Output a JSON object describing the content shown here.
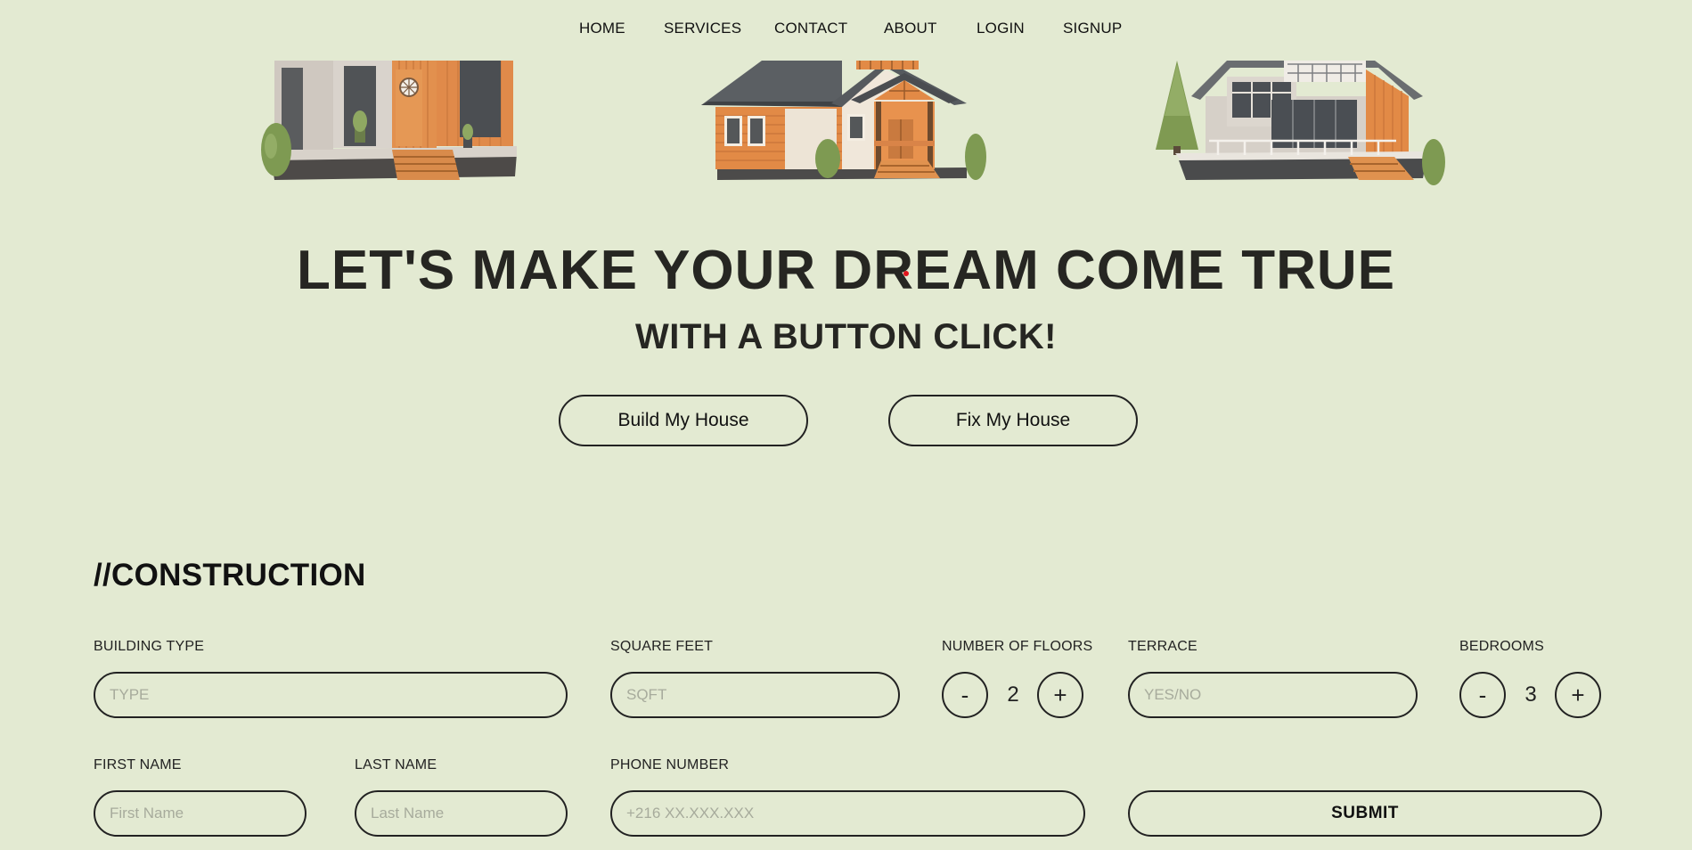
{
  "nav": {
    "items": [
      {
        "label": "HOME"
      },
      {
        "label": "SERVICES"
      },
      {
        "label": "CONTACT"
      },
      {
        "label": "ABOUT"
      },
      {
        "label": "LOGIN"
      },
      {
        "label": "SIGNUP"
      }
    ]
  },
  "hero": {
    "title": "LET'S MAKE YOUR DREAM COME TRUE",
    "subtitle": "WITH A BUTTON CLICK!",
    "build_label": "Build My House",
    "fix_label": "Fix My House"
  },
  "construction": {
    "title": "//CONSTRUCTION",
    "building_type": {
      "label": "BUILDING TYPE",
      "placeholder": "TYPE",
      "value": ""
    },
    "square_feet": {
      "label": "SQUARE FEET",
      "placeholder": "SQFT",
      "value": ""
    },
    "floors": {
      "label": "NUMBER OF FLOORS",
      "value": "2",
      "minus": "-",
      "plus": "+"
    },
    "terrace": {
      "label": "TERRACE",
      "placeholder": "YES/NO",
      "value": ""
    },
    "bedrooms": {
      "label": "BEDROOMS",
      "value": "3",
      "minus": "-",
      "plus": "+"
    },
    "first_name": {
      "label": "FIRST NAME",
      "placeholder": "First Name",
      "value": ""
    },
    "last_name": {
      "label": "LAST NAME",
      "placeholder": "Last Name",
      "value": ""
    },
    "phone": {
      "label": "PHONE NUMBER",
      "placeholder": "+216 XX.XXX.XXX",
      "value": ""
    },
    "submit_label": "SUBMIT"
  },
  "colors": {
    "background": "#e3ead2",
    "text": "#232320",
    "house_orange": "#e08a4a",
    "roof_gray": "#5b5f63",
    "tree_green": "#7f9a52"
  },
  "icons": {
    "house_1": "modern-house-illustration",
    "house_2": "cottage-house-illustration",
    "house_3": "chalet-house-illustration"
  }
}
